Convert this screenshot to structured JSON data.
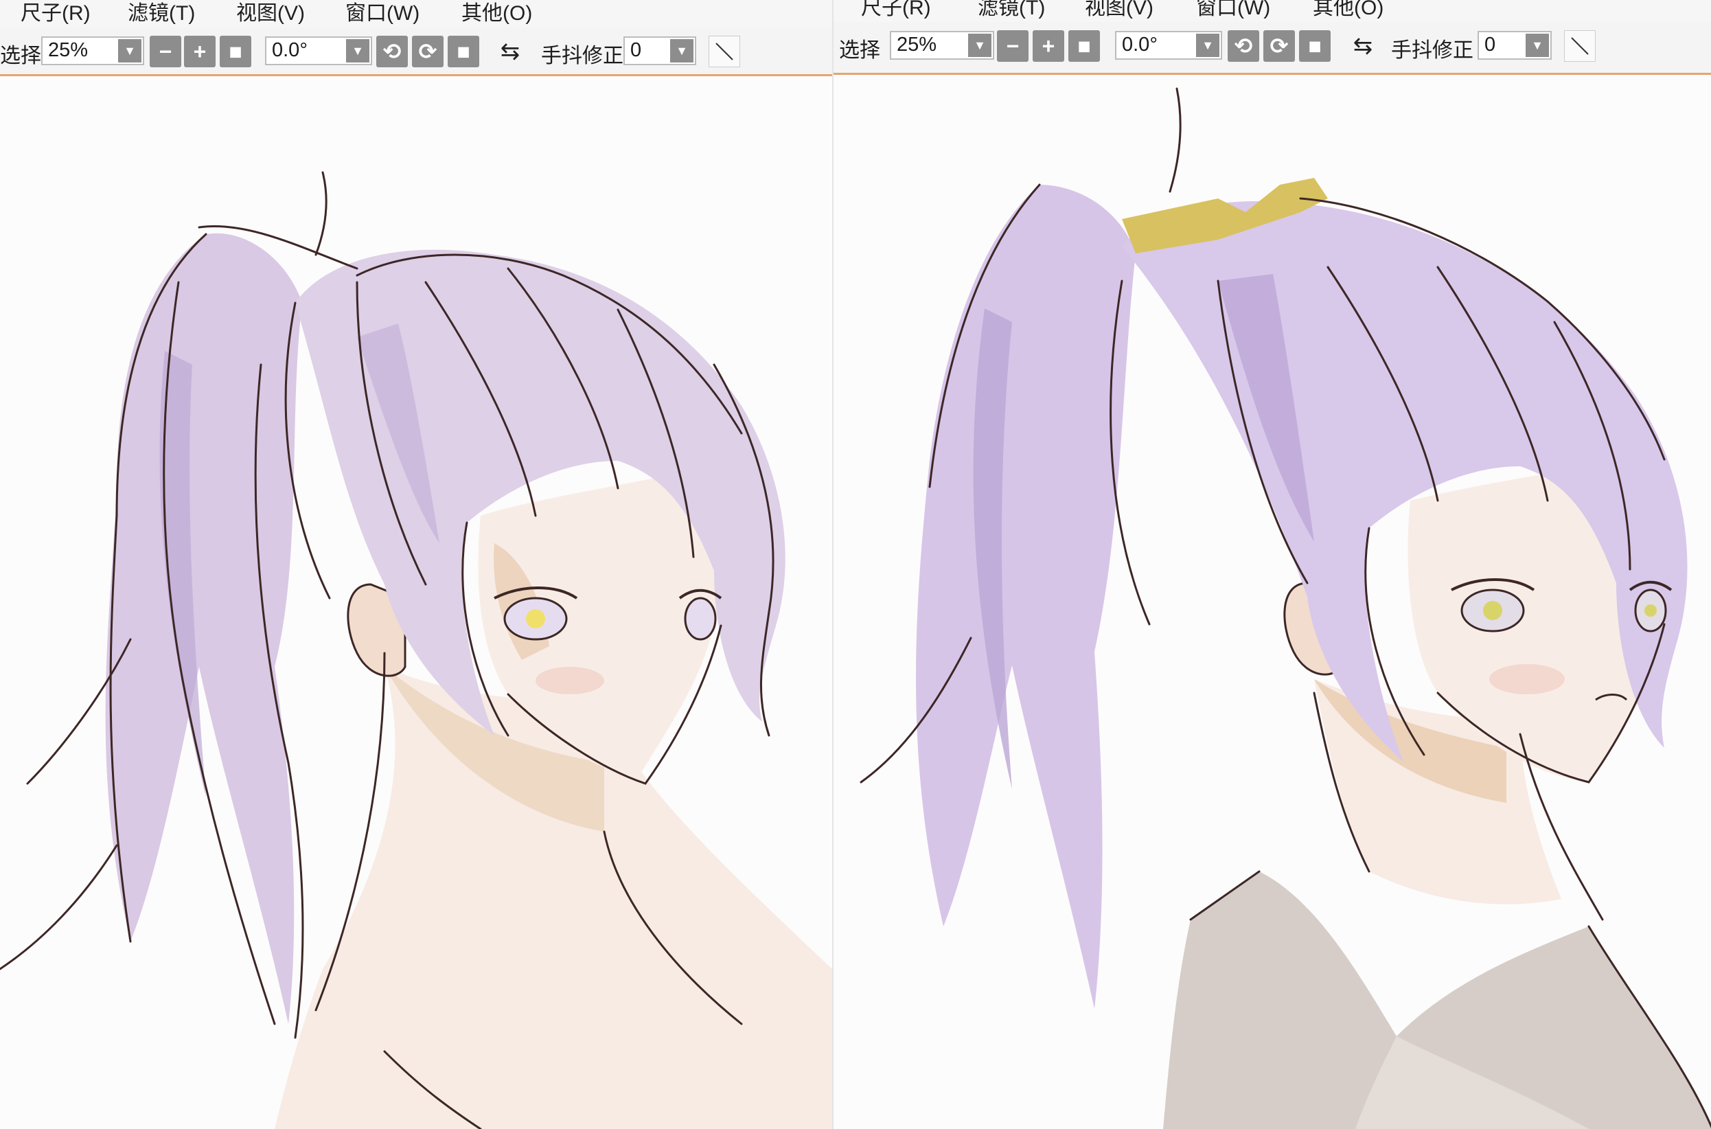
{
  "panels": [
    {
      "id": "left",
      "menu": [
        "尺子(R)",
        "滤镜(T)",
        "视图(V)",
        "窗口(W)",
        "其他(O)"
      ],
      "toolbar": {
        "select_label": "选择",
        "zoom_value": "25%",
        "rotation_value": "0.0°",
        "stabilizer_label": "手抖修正",
        "stabilizer_value": "0"
      }
    },
    {
      "id": "right",
      "menu": [
        "尺子(R)",
        "滤镜(T)",
        "视图(V)",
        "窗口(W)",
        "其他(O)"
      ],
      "toolbar": {
        "select_label": "选择",
        "zoom_value": "25%",
        "rotation_value": "0.0°",
        "stabilizer_label": "手抖修正",
        "stabilizer_value": "0"
      }
    }
  ],
  "icons": {
    "dropdown": "chevron-down-icon",
    "zoom_out": "minus-icon",
    "zoom_in": "plus-icon",
    "reset": "square-icon",
    "rotate_left": "rotate-ccw-icon",
    "rotate_right": "rotate-cw-icon",
    "flip": "flip-horizontal-icon",
    "line": "line-tool-icon"
  },
  "colors": {
    "toolbar_accent": "#e7a56f",
    "button_gray": "#8d8d8d",
    "hair": "#d7c7e3",
    "hair_shadow": "#bba6d4",
    "skin": "#f7ebe4",
    "skin_shadow": "#e7c7a7",
    "bow": "#d8c160",
    "clothes": "#d6cdc8",
    "line_art": "#3d2726"
  }
}
